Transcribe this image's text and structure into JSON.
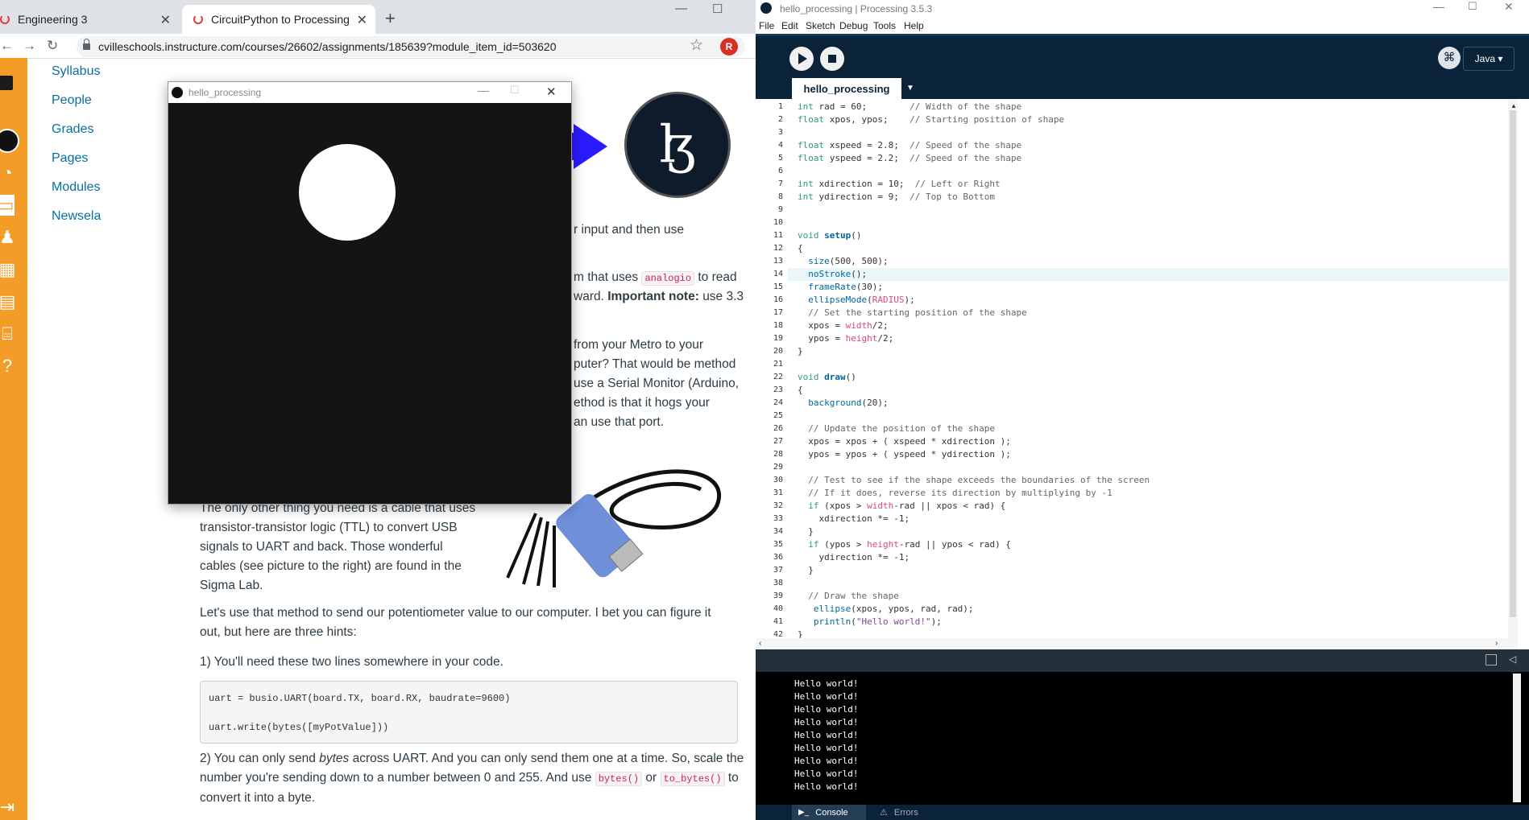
{
  "browser": {
    "tabs": [
      {
        "title": "Engineering 3",
        "active": false
      },
      {
        "title": "CircuitPython to Processing",
        "active": true
      }
    ],
    "url": "cvilleschools.instructure.com/courses/26602/assignments/185639?module_item_id=503620",
    "avatar_letter": "R",
    "course_nav": [
      "Syllabus",
      "People",
      "Grades",
      "Pages",
      "Modules",
      "Newsela"
    ],
    "page_text": {
      "frag1": "r input and then use",
      "frag2a": "m that uses",
      "frag2_code": "analogio",
      "frag2b": "to read",
      "frag3a": "ward.",
      "frag3_bold": "Important note:",
      "frag3b": "use 3.3",
      "frag4": "from your Metro to your",
      "frag5": "puter?  That would be method",
      "frag6": "use a Serial Monitor (Arduino,",
      "frag7": "ethod is that it hogs your",
      "frag8": "an use that port.",
      "cable_para": [
        "The only other thing you need is a cable that uses",
        "transistor-transistor logic (TTL) to convert USB",
        "signals to UART and back.  Those wonderful",
        "cables (see picture to the right) are found in the",
        "Sigma Lab."
      ],
      "method_para": [
        "Let's use that method to send our potentiometer value to our computer.  I bet you can figure it",
        "out, but here are three hints:"
      ],
      "hint1": "1) You'll need these two lines somewhere in your code.",
      "code_lines": [
        "uart = busio.UART(board.TX, board.RX, baudrate=9600)",
        "uart.write(bytes([myPotValue]))"
      ],
      "hint2_l1a": "2) You can only send ",
      "hint2_l1_em": "bytes",
      "hint2_l1b": " across UART.  And you can only send them one at a time.  So, scale the",
      "hint2_l2a": "number you're sending down to a number between 0 and 255.  And  use ",
      "hint2_code1": "bytes()",
      "hint2_or": " or ",
      "hint2_code2": "to_bytes()",
      "hint2_l2b": " to",
      "hint2_l3": "convert it into a byte."
    }
  },
  "sketch_window": {
    "title": "hello_processing"
  },
  "ide": {
    "window_title": "hello_processing | Processing 3.5.3",
    "menu": [
      "File",
      "Edit",
      "Sketch",
      "Debug",
      "Tools",
      "Help"
    ],
    "mode": "Java",
    "tab_name": "hello_processing",
    "console_lines": [
      "Hello world!",
      "Hello world!",
      "Hello world!",
      "Hello world!",
      "Hello world!",
      "Hello world!",
      "Hello world!",
      "Hello world!",
      "Hello world!"
    ],
    "console_tabs": [
      "Console",
      "Errors"
    ]
  }
}
